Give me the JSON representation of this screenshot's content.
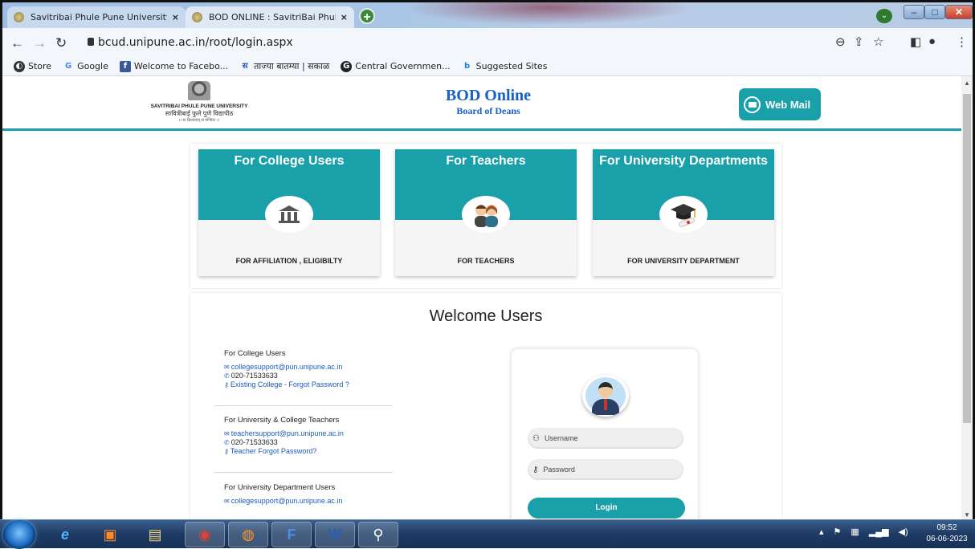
{
  "browser": {
    "tabs": [
      {
        "label": "Savitribai Phule Pune University",
        "close": "×"
      },
      {
        "label": "BOD ONLINE : SavitriBai Phule Pu",
        "close": "×"
      }
    ],
    "new_tab": "+",
    "url": "bcud.unipune.ac.in/root/login.aspx",
    "bookmarks": [
      "Store",
      "Google",
      "Welcome to Facebo...",
      "ताज्या बातम्या | सकाळ",
      "Central Governmen...",
      "Suggested Sites"
    ]
  },
  "header": {
    "logo_line1": "SAVITRIBAI PHULE PUNE UNIVERSITY",
    "logo_line2": "सावित्रीबाई फुले पुणे विद्यापीठ",
    "logo_line3": "।। यः क्रियावान् स पण्डितः ।।",
    "title": "BOD Online",
    "subtitle": "Board of Deans",
    "webmail": "Web Mail"
  },
  "cards": [
    {
      "title": "For College Users",
      "caption": "FOR AFFILIATION , ELIGIBILTY",
      "icon": "institution-icon"
    },
    {
      "title": "For Teachers",
      "caption": "FOR TEACHERS",
      "icon": "teachers-icon"
    },
    {
      "title": "For University Departments",
      "caption": "FOR UNIVERSITY DEPARTMENT",
      "icon": "graduation-cap-icon"
    }
  ],
  "welcome": {
    "title": "Welcome Users",
    "groups": [
      {
        "heading": "For College Users",
        "email": "collegesupport@pun.unipune.ac.in",
        "phone": "020-71533633",
        "link": "Existing College - Forgot Password ?"
      },
      {
        "heading": "For University & College Teachers",
        "email": "teachersupport@pun.unipune.ac.in",
        "phone": "020-71533633",
        "link": "Teacher Forgot Password?"
      },
      {
        "heading": "For University Department Users",
        "email": "collegesupport@pun.unipune.ac.in"
      }
    ],
    "login": {
      "username_placeholder": "Username",
      "password_placeholder": "Password",
      "button": "Login"
    }
  },
  "taskbar": {
    "time": "09:52",
    "date": "06-06-2023"
  },
  "colors": {
    "accent": "#1aa0a8",
    "brand_blue": "#1660c8"
  }
}
